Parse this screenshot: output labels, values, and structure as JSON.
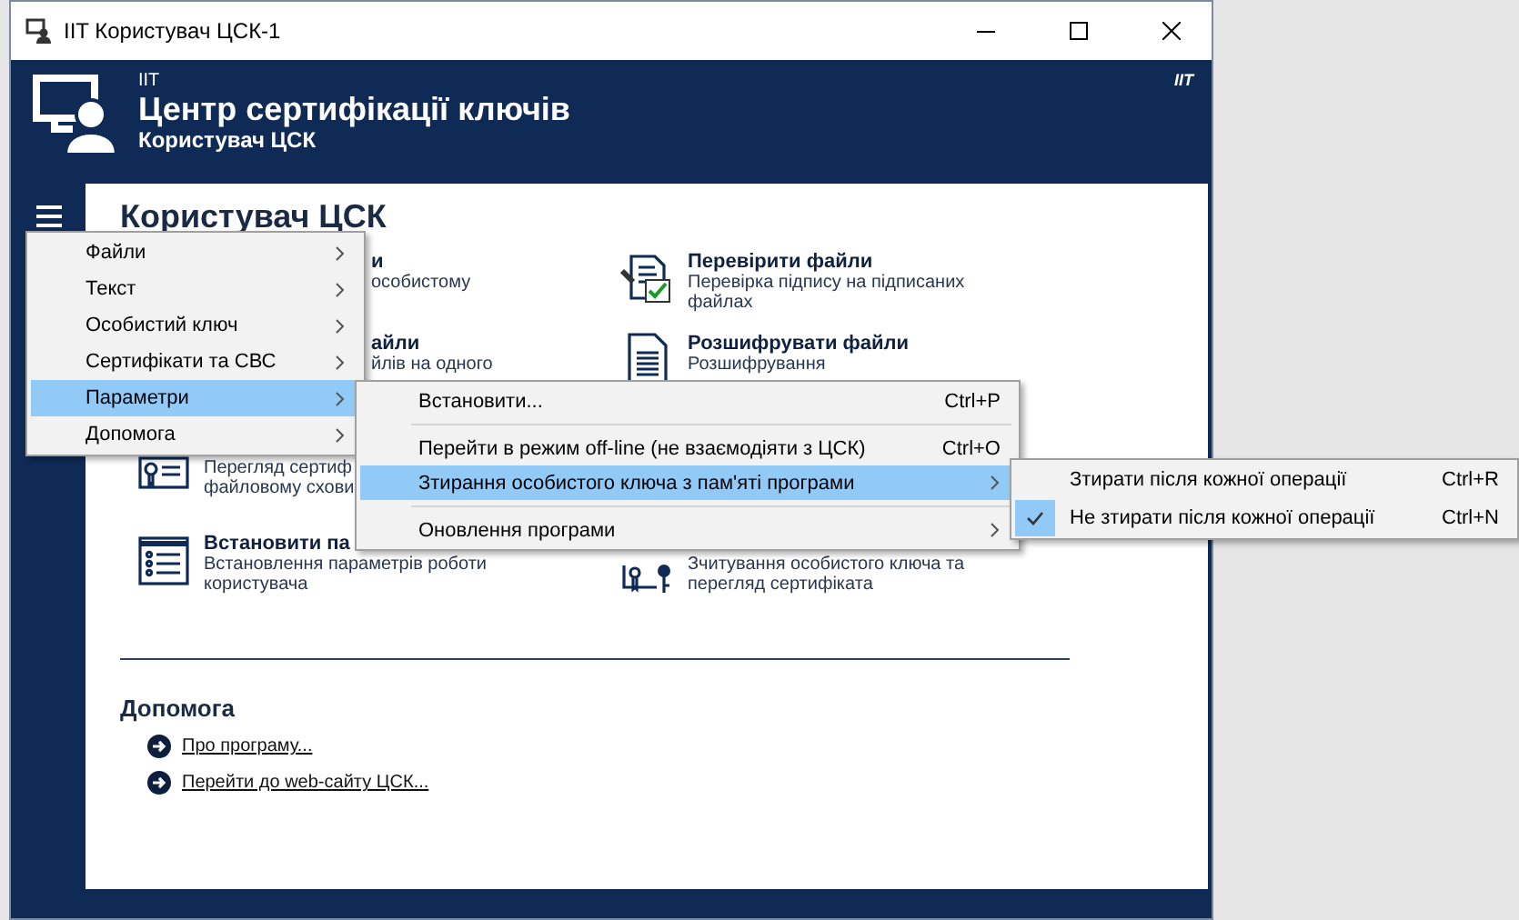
{
  "window": {
    "title": "IIT Користувач ЦСК-1"
  },
  "header": {
    "vendor": "IIT",
    "title": "Центр сертифікації ключів",
    "subtitle": "Користувач ЦСК",
    "brand": "IIT"
  },
  "page": {
    "heading": "Користувач ЦСК"
  },
  "tasks": [
    {
      "kind": "cut",
      "title": "и",
      "description": [
        "особистому"
      ]
    },
    {
      "kind": "whole",
      "title": "Перевірити файли",
      "description": [
        "Перевірка підпису на підписаних",
        "файлах"
      ]
    },
    {
      "kind": "cut",
      "title": "айли",
      "description": [
        "йлів на одного"
      ]
    },
    {
      "kind": "whole",
      "title": "Розшифрувати файли",
      "description": [
        "Розшифрування"
      ]
    },
    {
      "kind": "untitled",
      "description": [
        "Перегляд сертиф",
        "файловому схови"
      ]
    },
    {
      "kind": "whole",
      "title": "Встановити па",
      "description": [
        "Встановлення параметрів роботи",
        "користувача"
      ]
    },
    {
      "kind": "untitled",
      "description": [
        "Зчитування особистого ключа та",
        "перегляд сертифіката"
      ]
    }
  ],
  "help": {
    "heading": "Допомога",
    "links": [
      "Про програму...",
      "Перейти до web-сайту ЦСК..."
    ]
  },
  "menu": {
    "items": [
      {
        "label": "Файли",
        "selected": false
      },
      {
        "label": "Текст",
        "selected": false
      },
      {
        "label": "Особистий ключ",
        "selected": false
      },
      {
        "label": "Сертифікати та СВС",
        "selected": false
      },
      {
        "label": "Параметри",
        "selected": true
      },
      {
        "label": "Допомога",
        "selected": false
      }
    ]
  },
  "submenu": {
    "items": [
      {
        "kind": "command",
        "label": "Встановити...",
        "shortcut": "Ctrl+P",
        "selected": false
      },
      {
        "kind": "separator"
      },
      {
        "kind": "command",
        "label": "Перейти в режим off-line (не взаємодіяти з ЦСК)",
        "shortcut": "Ctrl+O",
        "selected": false
      },
      {
        "kind": "submenu",
        "label": "Зтирання особистого ключа з пам'яті програми",
        "selected": true
      },
      {
        "kind": "separator"
      },
      {
        "kind": "submenu",
        "label": "Оновлення програми",
        "selected": false
      }
    ]
  },
  "subsubmenu": {
    "items": [
      {
        "label": "Зтирати після кожної операції",
        "shortcut": "Ctrl+R",
        "checked": false
      },
      {
        "label": "Не зтирати після кожної операції",
        "shortcut": "Ctrl+N",
        "checked": true
      }
    ]
  }
}
